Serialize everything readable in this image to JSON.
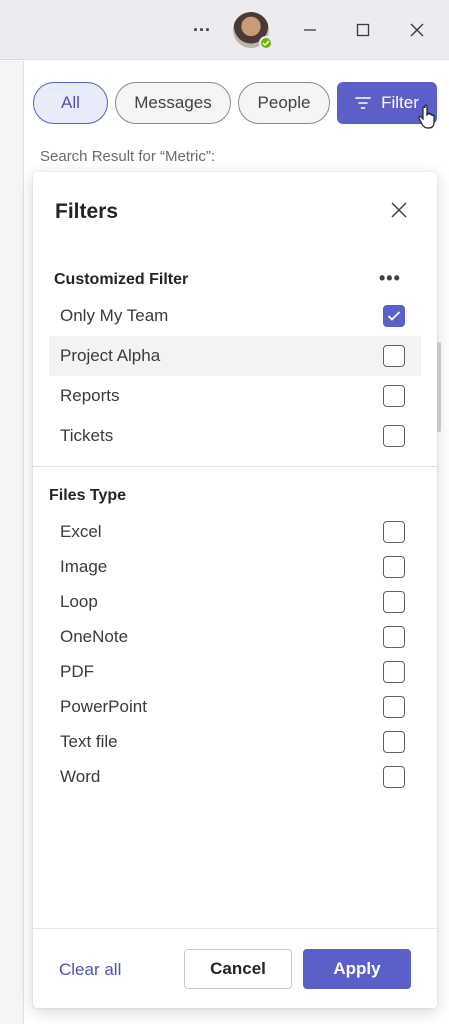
{
  "titlebar": {
    "more_label": "···",
    "icons": [
      "more-horizontal-icon",
      "avatar",
      "minimize-icon",
      "maximize-icon",
      "close-icon"
    ]
  },
  "tabs": [
    {
      "label": "All",
      "active": true
    },
    {
      "label": "Messages",
      "active": false
    },
    {
      "label": "People",
      "active": false
    },
    {
      "label": "Filter",
      "active": false,
      "icon": "filter-icon"
    }
  ],
  "search_result": "Search Result for “Metric”:",
  "filters": {
    "title": "Filters",
    "customized": {
      "title": "Customized Filter",
      "items": [
        {
          "label": "Only My Team",
          "checked": true
        },
        {
          "label": "Project Alpha",
          "checked": false
        },
        {
          "label": "Reports",
          "checked": false
        },
        {
          "label": "Tickets",
          "checked": false
        }
      ]
    },
    "files_type": {
      "title": "Files Type",
      "items": [
        {
          "label": "Excel",
          "checked": false
        },
        {
          "label": "Image",
          "checked": false
        },
        {
          "label": "Loop",
          "checked": false
        },
        {
          "label": "OneNote",
          "checked": false
        },
        {
          "label": "PDF",
          "checked": false
        },
        {
          "label": "PowerPoint",
          "checked": false
        },
        {
          "label": "Text file",
          "checked": false
        },
        {
          "label": "Word",
          "checked": false
        }
      ]
    },
    "clear_all": "Clear all",
    "cancel": "Cancel",
    "apply": "Apply"
  },
  "colors": {
    "accent": "#5b5fc7",
    "status_available": "#6bb700"
  }
}
